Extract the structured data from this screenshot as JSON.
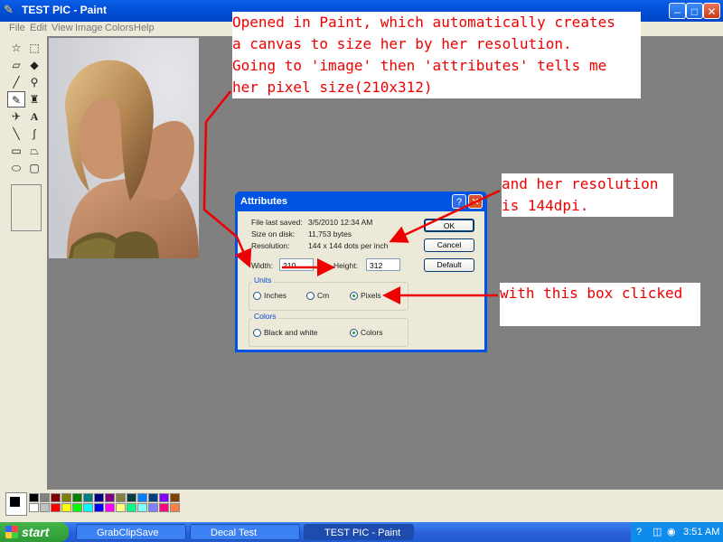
{
  "window": {
    "title": "TEST PIC - Paint",
    "minimize": "–",
    "maximize": "□",
    "close": "✕"
  },
  "menu": [
    "File",
    "Edit",
    "View",
    "Image",
    "Colors",
    "Help"
  ],
  "toolbox": {
    "tools": [
      "free-form-select",
      "select",
      "eraser",
      "fill",
      "pick-color",
      "magnifier",
      "pencil",
      "brush",
      "airbrush",
      "text",
      "line",
      "curve",
      "rectangle",
      "polygon",
      "ellipse",
      "rounded-rectangle"
    ],
    "selected": "pencil"
  },
  "palette": {
    "foreground": "#000000",
    "background": "#ffffff",
    "colors": [
      "#000000",
      "#808080",
      "#800000",
      "#808000",
      "#008000",
      "#008080",
      "#000080",
      "#800080",
      "#808040",
      "#004040",
      "#0080ff",
      "#004080",
      "#8000ff",
      "#804000",
      "#ffffff",
      "#c0c0c0",
      "#ff0000",
      "#ffff00",
      "#00ff00",
      "#00ffff",
      "#0000ff",
      "#ff00ff",
      "#ffff80",
      "#00ff80",
      "#80ffff",
      "#8080ff",
      "#ff0080",
      "#ff8040"
    ]
  },
  "dialog": {
    "title": "Attributes",
    "help": "?",
    "close": "✕",
    "file_last_saved_label": "File last saved:",
    "file_last_saved_value": "3/5/2010 12:34 AM",
    "size_on_disk_label": "Size on disk:",
    "size_on_disk_value": "11,753 bytes",
    "resolution_label": "Resolution:",
    "resolution_value": "144 x 144 dots per inch",
    "width_label": "Width:",
    "width_value": "210",
    "height_label": "Height:",
    "height_value": "312",
    "ok": "OK",
    "cancel": "Cancel",
    "default": "Default",
    "units_label": "Units",
    "units": [
      "Inches",
      "Cm",
      "Pixels"
    ],
    "units_selected": "Pixels",
    "colors_label": "Colors",
    "colors": [
      "Black and white",
      "Colors"
    ],
    "colors_selected": "Colors"
  },
  "annotations": {
    "note1": "Opened in Paint, which automatically creates\na canvas to size her by her resolution.\nGoing to 'image' then 'attributes' tells me\nher pixel size(210x312)",
    "note2": "and her resolution\nis 144dpi.",
    "note3": "with this box clicked"
  },
  "taskbar": {
    "start": "start",
    "tasks": [
      "GrabClipSave",
      "Decal Test",
      "TEST PIC - Paint"
    ],
    "active_task": "TEST PIC - Paint",
    "clock": "3:51 AM"
  }
}
